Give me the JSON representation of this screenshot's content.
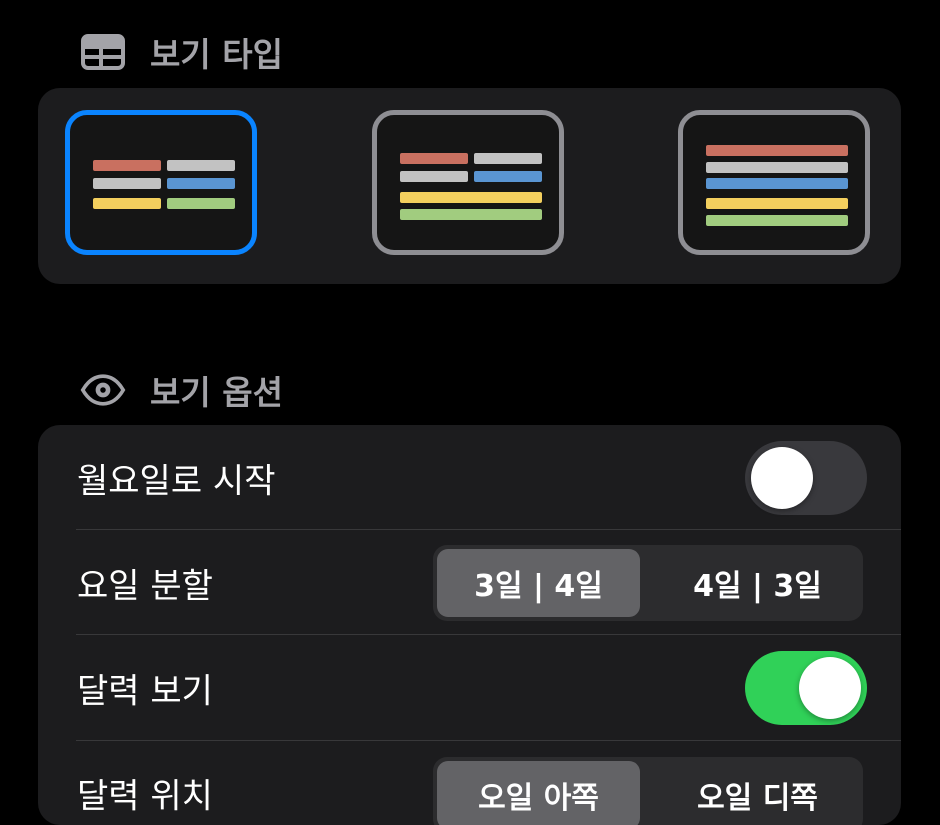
{
  "sections": {
    "view_type": {
      "title": "보기 타입",
      "icon": "table-icon"
    },
    "view_options": {
      "title": "보기 옵션",
      "icon": "eye-icon"
    }
  },
  "view_types": [
    {
      "name": "split-grid",
      "selected": true
    },
    {
      "name": "split-top-full-bottom",
      "selected": false
    },
    {
      "name": "full-rows",
      "selected": false
    }
  ],
  "options": {
    "start_monday": {
      "label": "월요일로 시작",
      "on": false
    },
    "day_split": {
      "label": "요일 분할",
      "segments": [
        "3일 | 4일",
        "4일 | 3일"
      ],
      "selected_index": 0
    },
    "show_calendar": {
      "label": "달력 보기",
      "on": true
    },
    "calendar_position": {
      "label": "달력 위치",
      "segments": [
        "오일 아쪽",
        "오일 디쪽"
      ],
      "selected_index": 0
    }
  },
  "colors": {
    "selected_border": "#0a84ff",
    "unselected_border": "#8e8e93",
    "toggle_on": "#30d158",
    "bar_red": "#c97060",
    "bar_gray": "#c2c2c2",
    "bar_blue": "#5a95d2",
    "bar_yellow": "#f3cf5e",
    "bar_green": "#a1cc7f"
  }
}
